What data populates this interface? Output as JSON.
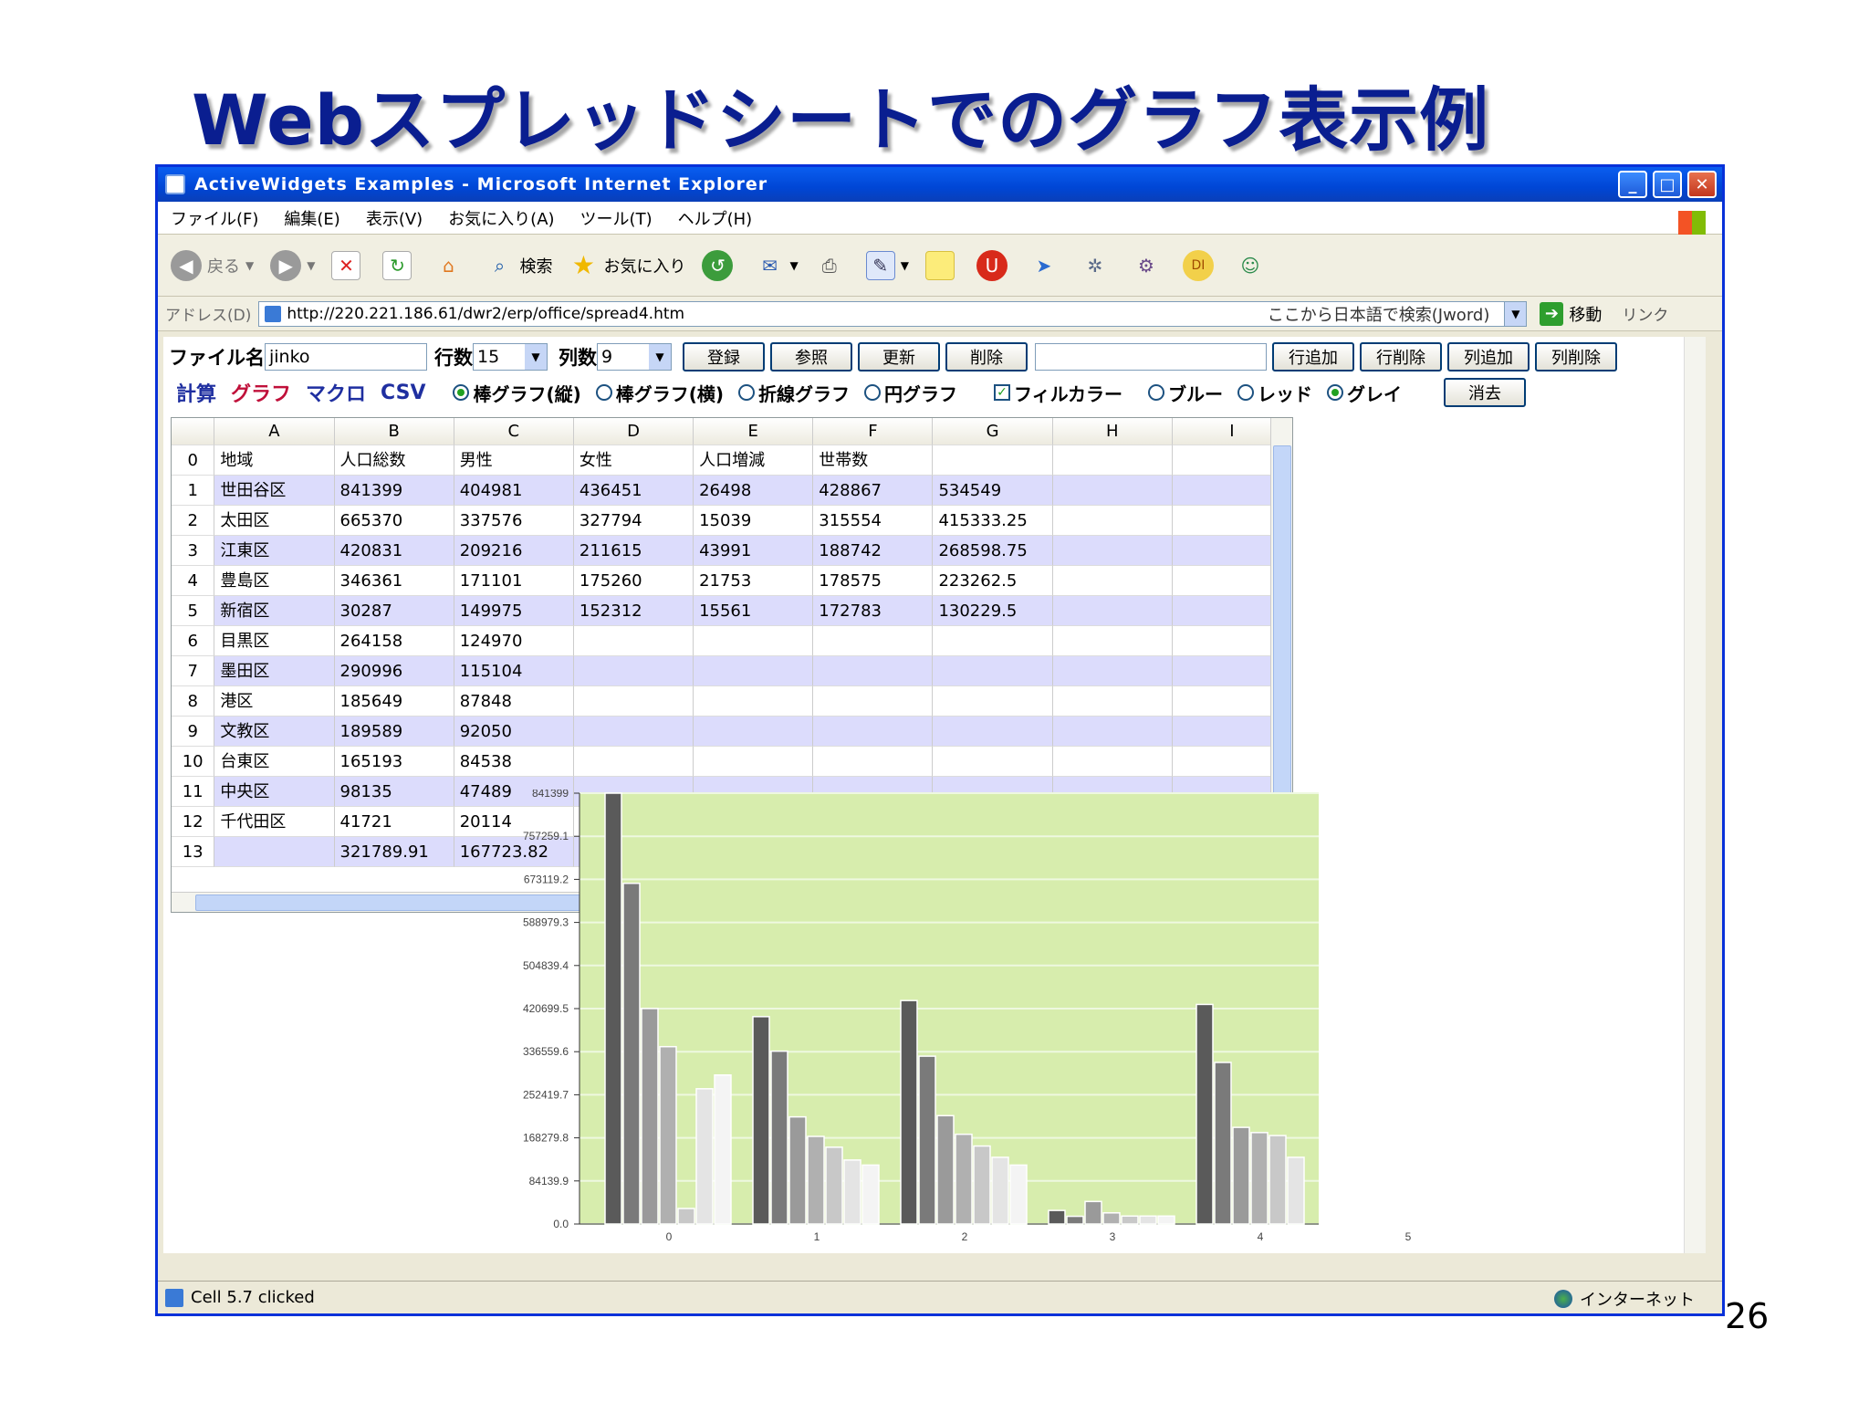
{
  "slide": {
    "title": "Webスプレッドシートでのグラフ表示例",
    "page_number": "26"
  },
  "window": {
    "title": "ActiveWidgets Examples - Microsoft Internet Explorer",
    "buttons": {
      "minimize": "_",
      "maximize": "□",
      "close": "✕"
    }
  },
  "menu": [
    "ファイル(F)",
    "編集(E)",
    "表示(V)",
    "お気に入り(A)",
    "ツール(T)",
    "ヘルプ(H)"
  ],
  "toolbar": {
    "back": "戻る",
    "search": "検索",
    "favorites": "お気に入り"
  },
  "address": {
    "label": "アドレス(D)",
    "url": "http://220.221.186.61/dwr2/erp/office/spread4.htm",
    "search_hint": "ここから日本語で検索(Jword)",
    "go": "移動",
    "links": "リンク"
  },
  "controls": {
    "file_label": "ファイル名",
    "file_value": "jinko",
    "rows_label": "行数",
    "rows_value": "15",
    "cols_label": "列数",
    "cols_value": "9",
    "btn_register": "登録",
    "btn_refer": "参照",
    "btn_update": "更新",
    "btn_delete": "削除",
    "btn_add_row": "行追加",
    "btn_del_row": "行削除",
    "btn_add_col": "列追加",
    "btn_del_col": "列削除",
    "btn_clear": "消去"
  },
  "modes": {
    "calc": "計算",
    "graph": "グラフ",
    "macro": "マクロ",
    "csv": "CSV",
    "calc_color": "#1f2fa0",
    "graph_color": "#c0103a",
    "macro_color": "#1f2fa0",
    "csv_color": "#1f2fa0"
  },
  "options": {
    "bar_v": "棒グラフ(縦)",
    "bar_h": "棒グラフ(横)",
    "line": "折線グラフ",
    "pie": "円グラフ",
    "fill_color": "フィルカラー",
    "blue": "ブルー",
    "red": "レッド",
    "gray": "グレイ"
  },
  "grid": {
    "columns": [
      "A",
      "B",
      "C",
      "D",
      "E",
      "F",
      "G",
      "H",
      "I"
    ],
    "rows": [
      {
        "n": "0",
        "cells": [
          "地域",
          "人口総数",
          "男性",
          "女性",
          "人口増減",
          "世帯数",
          "",
          "",
          ""
        ]
      },
      {
        "n": "1",
        "cells": [
          "世田谷区",
          "841399",
          "404981",
          "436451",
          "26498",
          "428867",
          "534549",
          "",
          ""
        ]
      },
      {
        "n": "2",
        "cells": [
          "太田区",
          "665370",
          "337576",
          "327794",
          "15039",
          "315554",
          "415333.25",
          "",
          ""
        ]
      },
      {
        "n": "3",
        "cells": [
          "江東区",
          "420831",
          "209216",
          "211615",
          "43991",
          "188742",
          "268598.75",
          "",
          ""
        ]
      },
      {
        "n": "4",
        "cells": [
          "豊島区",
          "346361",
          "171101",
          "175260",
          "21753",
          "178575",
          "223262.5",
          "",
          ""
        ]
      },
      {
        "n": "5",
        "cells": [
          "新宿区",
          "30287",
          "149975",
          "152312",
          "15561",
          "172783",
          "130229.5",
          "",
          ""
        ]
      },
      {
        "n": "6",
        "cells": [
          "目黒区",
          "264158",
          "124970",
          "",
          "",
          "",
          "",
          "",
          ""
        ]
      },
      {
        "n": "7",
        "cells": [
          "墨田区",
          "290996",
          "115104",
          "",
          "",
          "",
          "",
          "",
          ""
        ]
      },
      {
        "n": "8",
        "cells": [
          "港区",
          "185649",
          "87848",
          "",
          "",
          "",
          "",
          "",
          ""
        ]
      },
      {
        "n": "9",
        "cells": [
          "文教区",
          "189589",
          "92050",
          "",
          "",
          "",
          "",
          "",
          ""
        ]
      },
      {
        "n": "10",
        "cells": [
          "台東区",
          "165193",
          "84538",
          "",
          "",
          "",
          "",
          "",
          ""
        ]
      },
      {
        "n": "11",
        "cells": [
          "中央区",
          "98135",
          "47489",
          "",
          "",
          "",
          "",
          "",
          ""
        ]
      },
      {
        "n": "12",
        "cells": [
          "千代田区",
          "41721",
          "20114",
          "",
          "",
          "",
          "",
          "",
          ""
        ]
      },
      {
        "n": "13",
        "cells": [
          "",
          "321789.91",
          "167723.82",
          "",
          "",
          "",
          "",
          "",
          ""
        ]
      }
    ]
  },
  "status": {
    "text": "Cell 5.7 clicked",
    "zone": "インターネット"
  },
  "chart_data": {
    "type": "bar",
    "categories": [
      "0",
      "1",
      "2",
      "3",
      "4"
    ],
    "x_ticks": [
      "0",
      "1",
      "2",
      "3",
      "4",
      "5"
    ],
    "y_ticks": [
      "0.0",
      "84139.9",
      "168279.8",
      "252419.7",
      "336559.6",
      "420699.5",
      "504839.4",
      "588979.3",
      "673119.2",
      "757259.1",
      "841399"
    ],
    "ylim": [
      0,
      841399
    ],
    "series": [
      {
        "values": [
          841399,
          404981,
          436451,
          26498,
          428867
        ],
        "color": "#5a5a5a"
      },
      {
        "values": [
          665370,
          337576,
          327794,
          15039,
          315554
        ],
        "color": "#7a7a7a"
      },
      {
        "values": [
          420831,
          209216,
          211615,
          43991,
          188742
        ],
        "color": "#9a9a9a"
      },
      {
        "values": [
          346361,
          171101,
          175260,
          21753,
          178575
        ],
        "color": "#b0b0b0"
      },
      {
        "values": [
          30287,
          149975,
          152312,
          15561,
          172783
        ],
        "color": "#c8c8c8"
      },
      {
        "values": [
          264158,
          124970,
          130229.5,
          15561,
          130229.5
        ],
        "color": "#e4e4e4"
      },
      {
        "values": [
          290996,
          115104,
          115104,
          15561,
          0
        ],
        "color": "#f4f4f4"
      }
    ],
    "grid": true,
    "background": "#d7edad"
  }
}
